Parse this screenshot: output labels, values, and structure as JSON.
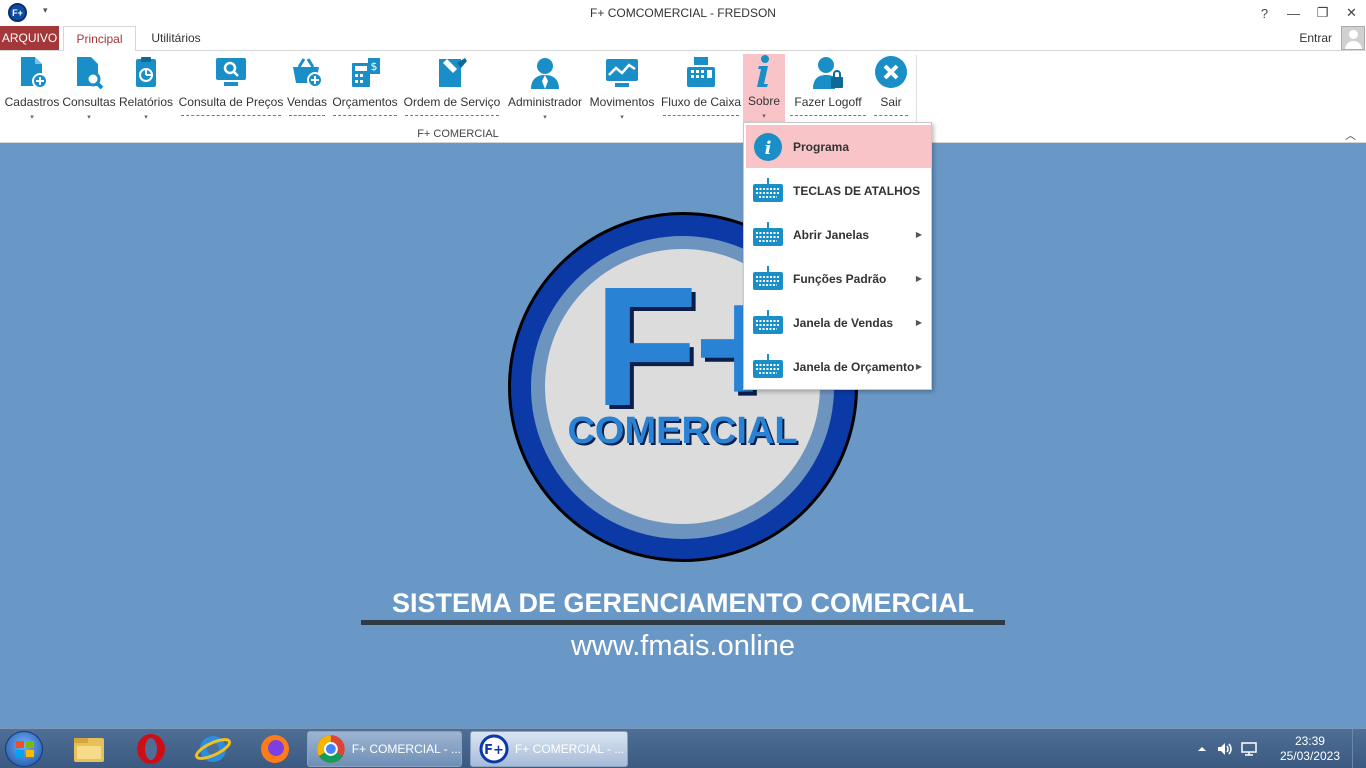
{
  "window": {
    "title": "F+ COMCOMERCIAL - FREDSON",
    "app_icon": "F+",
    "help": "?",
    "minimize": "—",
    "restore": "❐",
    "close": "✕"
  },
  "tabs": {
    "arquivo": "ARQUIVO",
    "principal": "Principal",
    "utilitarios": "Utilitários",
    "entrar": "Entrar"
  },
  "ribbon": {
    "group": "F+ COMERCIAL",
    "buttons": [
      {
        "label": "Cadastros"
      },
      {
        "label": "Consultas"
      },
      {
        "label": "Relatórios"
      },
      {
        "label": "Consulta de Preços"
      },
      {
        "label": "Vendas"
      },
      {
        "label": "Orçamentos"
      },
      {
        "label": "Ordem de Serviço"
      },
      {
        "label": "Administrador"
      },
      {
        "label": "Movimentos"
      },
      {
        "label": "Fluxo de Caixa"
      },
      {
        "label": "Sobre"
      },
      {
        "label": "Fazer Logoff"
      },
      {
        "label": "Sair"
      }
    ]
  },
  "menu": {
    "items": [
      {
        "label": "Programa"
      },
      {
        "label": "TECLAS DE ATALHOS"
      },
      {
        "label": "Abrir Janelas"
      },
      {
        "label": "Funções Padrão"
      },
      {
        "label": "Janela de Vendas"
      },
      {
        "label": "Janela de Orçamento"
      }
    ]
  },
  "logo": {
    "mark": "F+",
    "word": "COMERCIAL",
    "tagline": "SISTEMA DE GERENCIAMENTO COMERCIAL",
    "website": "www.fmais.online"
  },
  "taskbar": {
    "tasks": [
      {
        "label": "F+ COMERCIAL - ..."
      },
      {
        "label": "F+ COMERCIAL - ..."
      }
    ],
    "time": "23:39",
    "date": "25/03/2023"
  },
  "colors": {
    "accent": "#a4373a",
    "icon_blue": "#1a8fc7",
    "highlight": "#f8c4c8",
    "background": "#6a98c6"
  }
}
